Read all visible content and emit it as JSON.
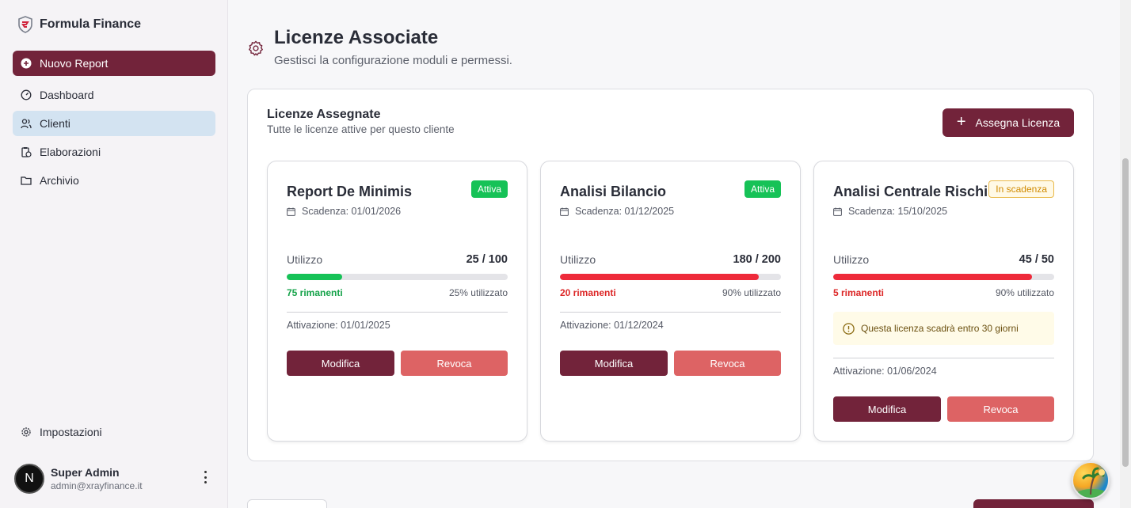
{
  "brand": {
    "name": "Formula Finance"
  },
  "sidebar": {
    "items": [
      {
        "label": "Nuovo Report",
        "icon": "plus-circle-icon"
      },
      {
        "label": "Dashboard",
        "icon": "gauge-icon"
      },
      {
        "label": "Clienti",
        "icon": "users-icon"
      },
      {
        "label": "Elaborazioni",
        "icon": "clipboard-clock-icon"
      },
      {
        "label": "Archivio",
        "icon": "folder-icon"
      }
    ],
    "settings": {
      "label": "Impostazioni",
      "icon": "gear-icon"
    },
    "user": {
      "initial": "N",
      "name": "Super Admin",
      "email": "admin@xrayfinance.it"
    }
  },
  "header": {
    "title": "Licenze Associate",
    "subtitle": "Gestisci la configurazione moduli e permessi."
  },
  "panel": {
    "title": "Licenze Assegnate",
    "subtitle": "Tutte le licenze attive per questo cliente",
    "assign_label": "Assegna Licenza"
  },
  "cards": [
    {
      "title": "Report De Minimis",
      "badge": "Attiva",
      "expiry": "Scadenza: 01/01/2026",
      "usage_label": "Utilizzo",
      "usage": "25 / 100",
      "usage_fraction": 0.25,
      "remaining": "75 rimanenti",
      "used_pct": "25% utilizzato",
      "activation": "Attivazione: 01/01/2025",
      "edit_label": "Modifica",
      "revoke_label": "Revoca",
      "status_color": "#16c257"
    },
    {
      "title": "Analisi Bilancio",
      "badge": "Attiva",
      "expiry": "Scadenza: 01/12/2025",
      "usage_label": "Utilizzo",
      "usage": "180 / 200",
      "usage_fraction": 0.9,
      "remaining": "20 rimanenti",
      "used_pct": "90% utilizzato",
      "activation": "Attivazione: 01/12/2024",
      "edit_label": "Modifica",
      "revoke_label": "Revoca",
      "status_color": "#ee2a3a"
    },
    {
      "title": "Analisi Centrale Rischi",
      "badge": "In scadenza",
      "expiry": "Scadenza: 15/10/2025",
      "usage_label": "Utilizzo",
      "usage": "45 / 50",
      "usage_fraction": 0.9,
      "remaining": "5 rimanenti",
      "used_pct": "90% utilizzato",
      "warning": "Questa licenza scadrà entro 30 giorni",
      "activation": "Attivazione: 01/06/2024",
      "edit_label": "Modifica",
      "revoke_label": "Revoca",
      "status_color": "#ee2a3a"
    }
  ],
  "colors": {
    "primary": "#72233a",
    "active_nav": "#d3e3f1",
    "revoke": "#dd6364",
    "success": "#16c257",
    "danger": "#ee2a3a",
    "warning": "#e9b949"
  }
}
